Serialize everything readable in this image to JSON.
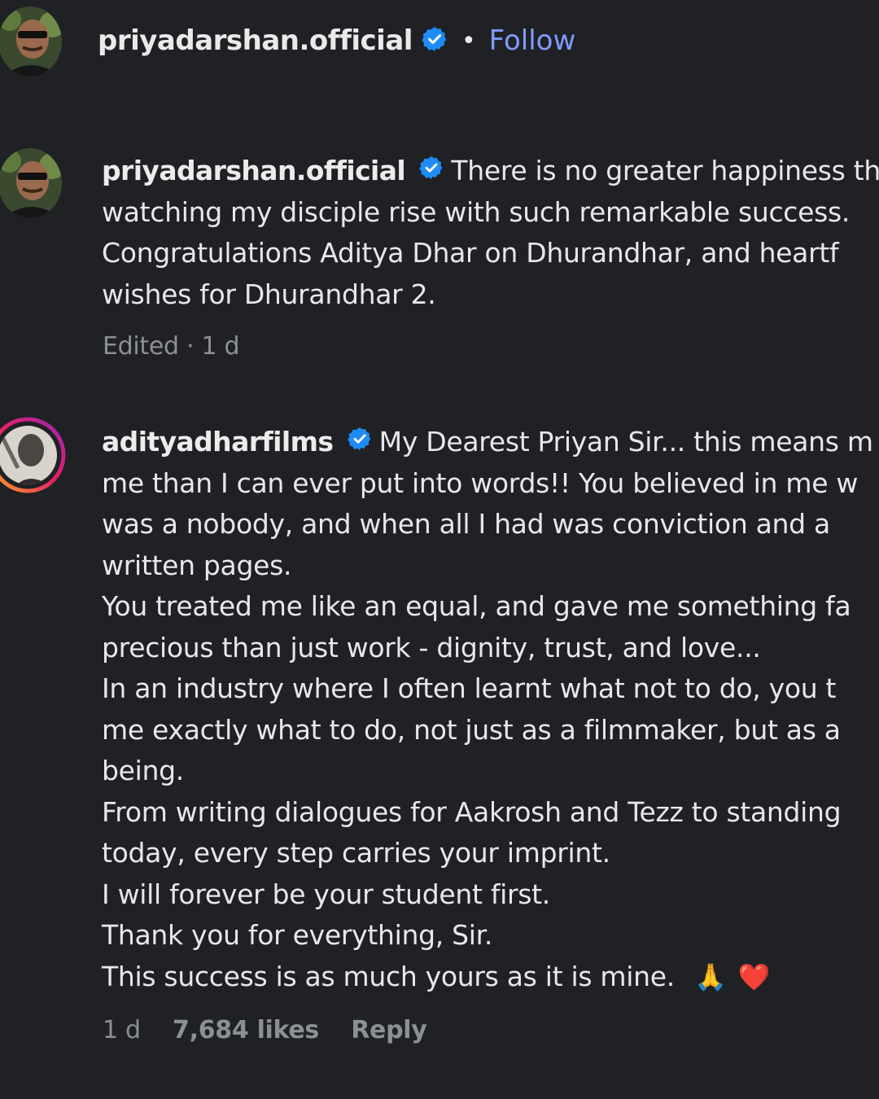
{
  "header": {
    "username": "priyadarshan.official",
    "separator": "•",
    "follow_label": "Follow"
  },
  "comments": [
    {
      "username": "priyadarshan.official",
      "lines": [
        "There is no greater happiness th",
        "watching my disciple rise with such remarkable success.",
        "Congratulations Aditya Dhar on Dhurandhar, and heartf",
        "wishes for Dhurandhar 2."
      ],
      "meta": "Edited · 1 d"
    },
    {
      "username": "adityadharfilms",
      "lines": [
        "My Dearest Priyan Sir... this means m",
        "me than I can ever put into words!! You believed in me w",
        "was a nobody, and when all I had was conviction and a",
        "written pages.",
        "You treated me like an equal, and gave me something fa",
        "precious than just work - dignity, trust, and love...",
        "In an industry where I often learnt what not to do, you t",
        "me exactly what to do, not just as a filmmaker, but as a",
        "being.",
        "From writing dialogues for Aakrosh and Tezz to standing",
        "today, every step carries your imprint.",
        "I will forever be your student first.",
        "Thank you for everything, Sir.",
        "This success is as much yours as it is mine."
      ],
      "emojis": [
        "🙏",
        "❤️"
      ],
      "meta_time": "1 d",
      "meta_likes": "7,684 likes",
      "meta_reply": "Reply"
    }
  ],
  "icons": {
    "verified": "verified-badge-icon",
    "verified_color": "#1d8cf8"
  }
}
